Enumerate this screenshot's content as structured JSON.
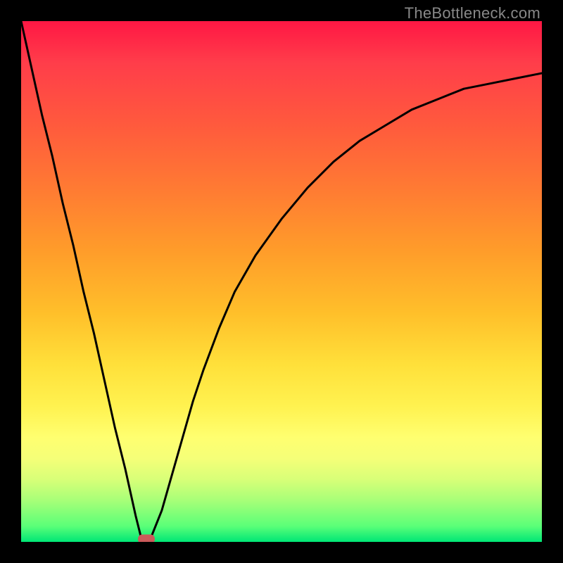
{
  "watermark": "TheBottleneck.com",
  "colors": {
    "curve": "#000000",
    "marker": "#ca5a5a",
    "background_frame": "#000000"
  },
  "chart_data": {
    "type": "line",
    "title": "",
    "xlabel": "",
    "ylabel": "",
    "xlim": [
      0,
      100
    ],
    "ylim": [
      0,
      100
    ],
    "grid": false,
    "legend": false,
    "series": [
      {
        "name": "curve",
        "x": [
          0,
          2,
          4,
          6,
          8,
          10,
          12,
          14,
          16,
          18,
          20,
          22,
          23,
          24,
          25,
          27,
          29,
          31,
          33,
          35,
          38,
          41,
          45,
          50,
          55,
          60,
          65,
          70,
          75,
          80,
          85,
          90,
          95,
          100
        ],
        "y": [
          100,
          91,
          82,
          74,
          65,
          57,
          48,
          40,
          31,
          22,
          14,
          5,
          1,
          0,
          1,
          6,
          13,
          20,
          27,
          33,
          41,
          48,
          55,
          62,
          68,
          73,
          77,
          80,
          83,
          85,
          87,
          88,
          89,
          90
        ]
      }
    ],
    "annotations": [
      {
        "name": "bottleneck-marker",
        "x": 24,
        "y": 0.5
      }
    ],
    "background": "vertical rainbow gradient red (top) to green (bottom)"
  }
}
